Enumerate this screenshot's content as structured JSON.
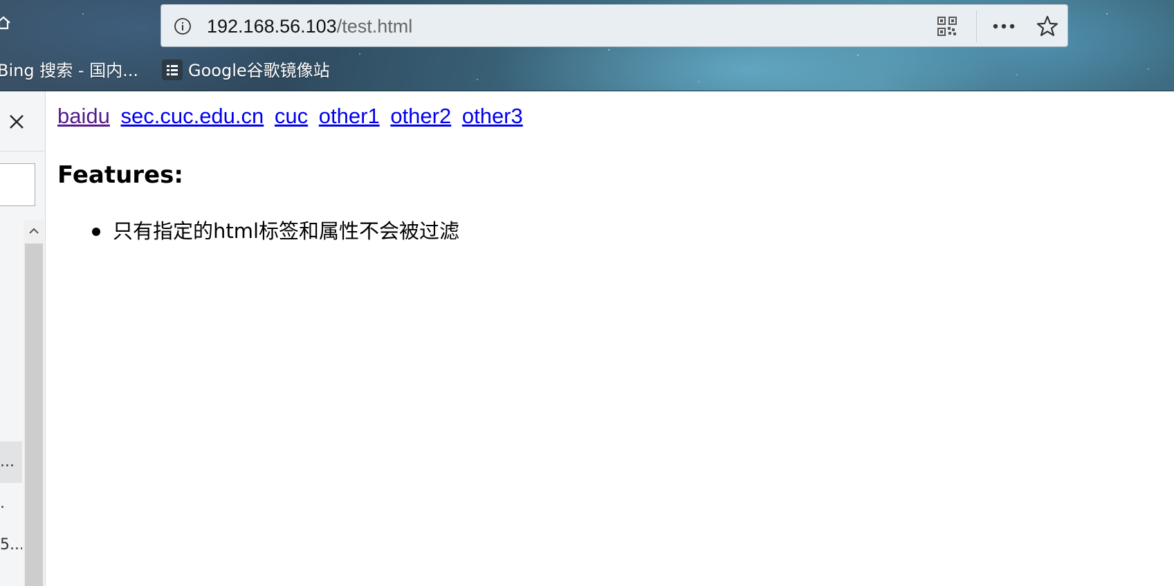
{
  "browser": {
    "url_host": "192.168.56.103",
    "url_path": "/test.html",
    "icons": {
      "home": "home-icon",
      "info": "info-icon",
      "qr": "qr-code-icon",
      "more": "more-icon",
      "star": "bookmark-star-icon"
    }
  },
  "bookmarks": [
    {
      "label": "Bing 搜索 - 国内..."
    },
    {
      "label": "Google谷歌镜像站",
      "icon": "bookmark-page-icon"
    }
  ],
  "sidepanel": {
    "close_icon": "close-icon",
    "items": [
      {
        "label": "..."
      },
      {
        "label": "."
      },
      {
        "label": "5..."
      }
    ]
  },
  "page": {
    "links": [
      {
        "label": "baidu",
        "visited": true
      },
      {
        "label": "sec.cuc.edu.cn",
        "visited": false
      },
      {
        "label": "cuc",
        "visited": false
      },
      {
        "label": "other1",
        "visited": false
      },
      {
        "label": "other2",
        "visited": false
      },
      {
        "label": "other3",
        "visited": false
      }
    ],
    "heading": "Features:",
    "features": [
      "只有指定的html标签和属性不会被过滤"
    ]
  },
  "colors": {
    "link": "#0000ee",
    "visited_link": "#551a8b"
  }
}
